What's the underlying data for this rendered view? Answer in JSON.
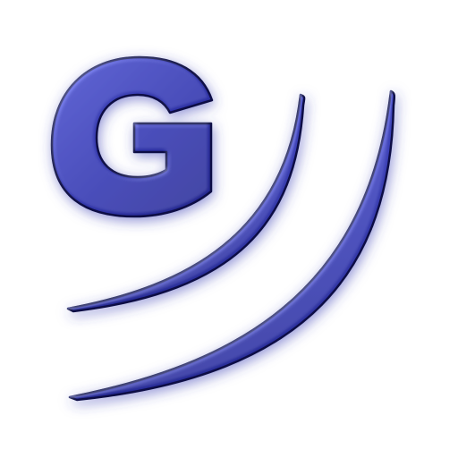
{
  "logo": {
    "letter": "G",
    "icon": "g-with-waves-logo-icon",
    "colors": {
      "fill_light": "#4a4fc2",
      "fill_mid": "#2f33a8",
      "fill_dark": "#1c1f7a",
      "outline": "#0d0f45",
      "glow": "#7d80d8",
      "background": "#ffffff"
    }
  }
}
